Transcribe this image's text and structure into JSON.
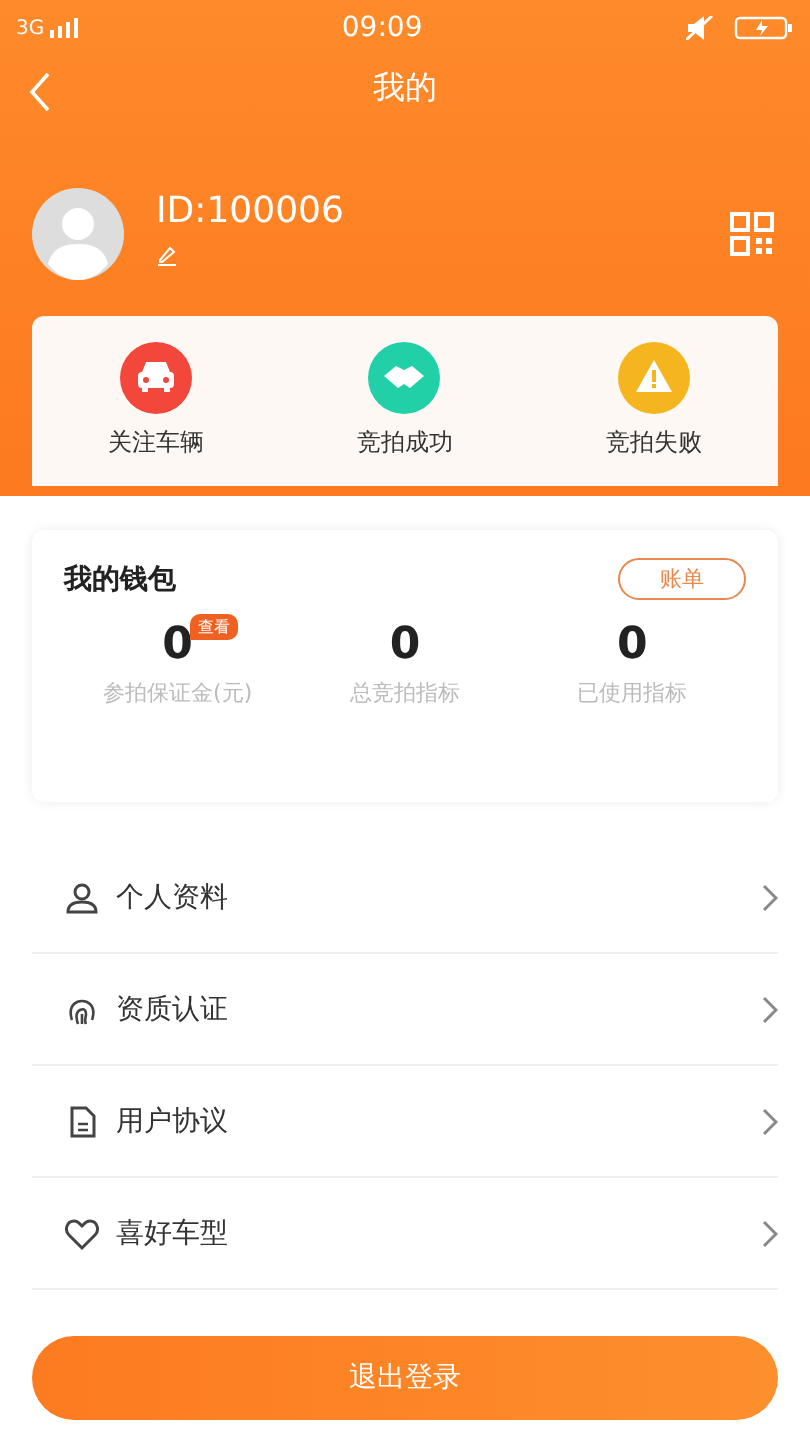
{
  "status_bar": {
    "network": "3G",
    "time": "09:09"
  },
  "header": {
    "title": "我的"
  },
  "profile": {
    "id": "ID:100006"
  },
  "shortcuts": [
    {
      "label": "关注车辆",
      "kind": "car",
      "color": "#f2473a"
    },
    {
      "label": "竞拍成功",
      "kind": "handshake",
      "color": "#22d0a8"
    },
    {
      "label": "竞拍失败",
      "kind": "warning",
      "color": "#f5b51f"
    }
  ],
  "wallet": {
    "title": "我的钱包",
    "bill_button": "账单",
    "stats": [
      {
        "value": "0",
        "label": "参拍保证金(元)",
        "badge": "查看"
      },
      {
        "value": "0",
        "label": "总竞拍指标"
      },
      {
        "value": "0",
        "label": "已使用指标"
      }
    ]
  },
  "menu": [
    {
      "label": "个人资料",
      "kind": "person"
    },
    {
      "label": "资质认证",
      "kind": "fingerprint"
    },
    {
      "label": "用户协议",
      "kind": "document"
    },
    {
      "label": "喜好车型",
      "kind": "heart"
    }
  ],
  "logout_button": "退出登录"
}
